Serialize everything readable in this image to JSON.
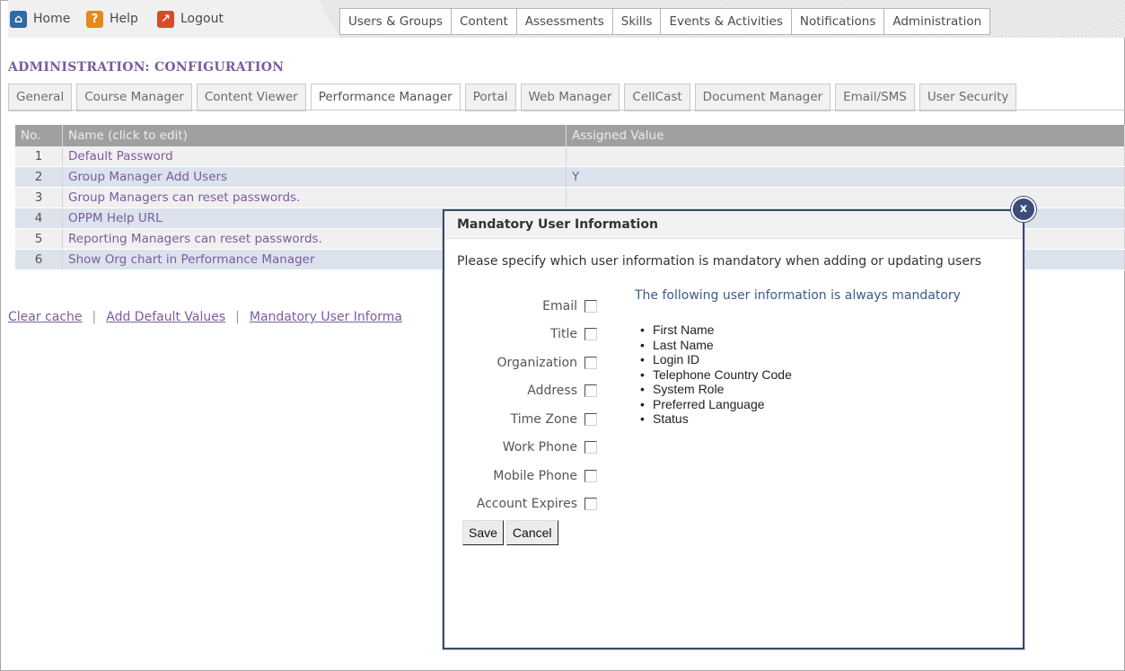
{
  "utility_nav": {
    "home": "Home",
    "help": "Help",
    "logout": "Logout"
  },
  "main_tabs": [
    "Users & Groups",
    "Content",
    "Assessments",
    "Skills",
    "Events & Activities",
    "Notifications",
    "Administration"
  ],
  "page_title": "ADMINISTRATION: CONFIGURATION",
  "sub_tabs": [
    "General",
    "Course Manager",
    "Content Viewer",
    "Performance Manager",
    "Portal",
    "Web Manager",
    "CellCast",
    "Document Manager",
    "Email/SMS",
    "User Security"
  ],
  "active_sub_tab": "Performance Manager",
  "table": {
    "headers": [
      "No.",
      "Name (click to edit)",
      "Assigned Value"
    ],
    "rows": [
      {
        "no": "1",
        "name": "Default Password",
        "value": ""
      },
      {
        "no": "2",
        "name": "Group Manager Add Users",
        "value": "Y"
      },
      {
        "no": "3",
        "name": "Group Managers can reset passwords.",
        "value": ""
      },
      {
        "no": "4",
        "name": "OPPM Help URL",
        "value": ""
      },
      {
        "no": "5",
        "name": "Reporting Managers can reset passwords.",
        "value": ""
      },
      {
        "no": "6",
        "name": "Show Org chart in Performance Manager",
        "value": ""
      }
    ]
  },
  "bottom_links": {
    "clear_cache": "Clear cache",
    "add_defaults": "Add Default Values",
    "mandatory_info": "Mandatory User Informa"
  },
  "modal": {
    "title": "Mandatory User Information",
    "description": "Please specify which user information is mandatory when adding or updating users",
    "options": [
      {
        "label": "Email",
        "checked": false
      },
      {
        "label": "Title",
        "checked": false
      },
      {
        "label": "Organization",
        "checked": false
      },
      {
        "label": "Address",
        "checked": false
      },
      {
        "label": "Time Zone",
        "checked": false
      },
      {
        "label": "Work Phone",
        "checked": false
      },
      {
        "label": "Mobile Phone",
        "checked": false
      },
      {
        "label": "Account Expires",
        "checked": false
      }
    ],
    "always_title": "The following user information is always mandatory",
    "always_items": [
      "First Name",
      "Last Name",
      "Login ID",
      "Telephone Country Code",
      "System Role",
      "Preferred Language",
      "Status"
    ],
    "save_label": "Save",
    "cancel_label": "Cancel",
    "close_glyph": "x"
  },
  "colors": {
    "accent": "#7a5ca0",
    "header_bg": "#a0a0a0",
    "row_alt": "#dce3ec",
    "modal_border": "#3a4a6a",
    "link_blue": "#3b5b8c"
  }
}
